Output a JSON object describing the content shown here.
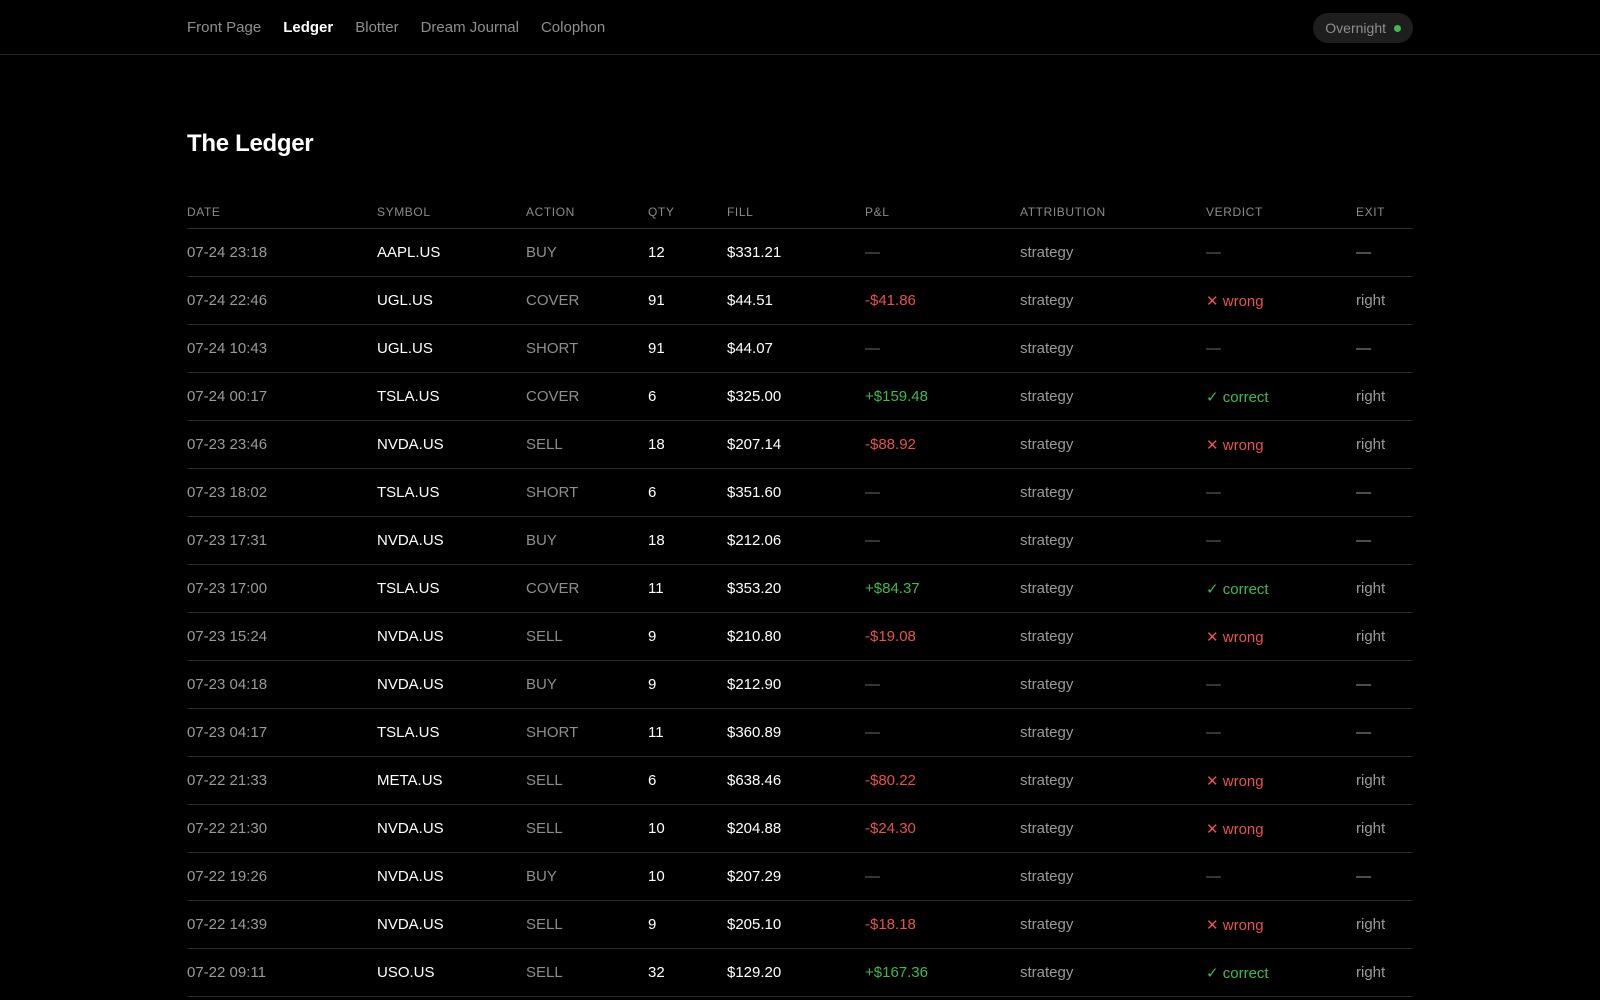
{
  "nav": {
    "items": [
      {
        "label": "Front Page",
        "active": false
      },
      {
        "label": "Ledger",
        "active": true
      },
      {
        "label": "Blotter",
        "active": false
      },
      {
        "label": "Dream Journal",
        "active": false
      },
      {
        "label": "Colophon",
        "active": false
      }
    ]
  },
  "status": {
    "label": "Overnight",
    "dot_color": "#3fb950"
  },
  "page": {
    "title": "The Ledger"
  },
  "table": {
    "headers": [
      "DATE",
      "SYMBOL",
      "ACTION",
      "QTY",
      "FILL",
      "P&L",
      "ATTRIBUTION",
      "VERDICT",
      "EXIT"
    ],
    "rows": [
      {
        "date": "07-24 23:18",
        "symbol": "AAPL.US",
        "action": "BUY",
        "qty": "12",
        "fill": "$331.21",
        "pnl": "—",
        "pnl_tone": "neutral",
        "attribution": "strategy",
        "verdict": "—",
        "verdict_tone": "neutral",
        "exit": "—"
      },
      {
        "date": "07-24 22:46",
        "symbol": "UGL.US",
        "action": "COVER",
        "qty": "91",
        "fill": "$44.51",
        "pnl": "-$41.86",
        "pnl_tone": "neg",
        "attribution": "strategy",
        "verdict": "✕ wrong",
        "verdict_tone": "neg",
        "exit": "right"
      },
      {
        "date": "07-24 10:43",
        "symbol": "UGL.US",
        "action": "SHORT",
        "qty": "91",
        "fill": "$44.07",
        "pnl": "—",
        "pnl_tone": "neutral",
        "attribution": "strategy",
        "verdict": "—",
        "verdict_tone": "neutral",
        "exit": "—"
      },
      {
        "date": "07-24 00:17",
        "symbol": "TSLA.US",
        "action": "COVER",
        "qty": "6",
        "fill": "$325.00",
        "pnl": "+$159.48",
        "pnl_tone": "pos",
        "attribution": "strategy",
        "verdict": "✓ correct",
        "verdict_tone": "pos",
        "exit": "right"
      },
      {
        "date": "07-23 23:46",
        "symbol": "NVDA.US",
        "action": "SELL",
        "qty": "18",
        "fill": "$207.14",
        "pnl": "-$88.92",
        "pnl_tone": "neg",
        "attribution": "strategy",
        "verdict": "✕ wrong",
        "verdict_tone": "neg",
        "exit": "right"
      },
      {
        "date": "07-23 18:02",
        "symbol": "TSLA.US",
        "action": "SHORT",
        "qty": "6",
        "fill": "$351.60",
        "pnl": "—",
        "pnl_tone": "neutral",
        "attribution": "strategy",
        "verdict": "—",
        "verdict_tone": "neutral",
        "exit": "—"
      },
      {
        "date": "07-23 17:31",
        "symbol": "NVDA.US",
        "action": "BUY",
        "qty": "18",
        "fill": "$212.06",
        "pnl": "—",
        "pnl_tone": "neutral",
        "attribution": "strategy",
        "verdict": "—",
        "verdict_tone": "neutral",
        "exit": "—"
      },
      {
        "date": "07-23 17:00",
        "symbol": "TSLA.US",
        "action": "COVER",
        "qty": "11",
        "fill": "$353.20",
        "pnl": "+$84.37",
        "pnl_tone": "pos",
        "attribution": "strategy",
        "verdict": "✓ correct",
        "verdict_tone": "pos",
        "exit": "right"
      },
      {
        "date": "07-23 15:24",
        "symbol": "NVDA.US",
        "action": "SELL",
        "qty": "9",
        "fill": "$210.80",
        "pnl": "-$19.08",
        "pnl_tone": "neg",
        "attribution": "strategy",
        "verdict": "✕ wrong",
        "verdict_tone": "neg",
        "exit": "right"
      },
      {
        "date": "07-23 04:18",
        "symbol": "NVDA.US",
        "action": "BUY",
        "qty": "9",
        "fill": "$212.90",
        "pnl": "—",
        "pnl_tone": "neutral",
        "attribution": "strategy",
        "verdict": "—",
        "verdict_tone": "neutral",
        "exit": "—"
      },
      {
        "date": "07-23 04:17",
        "symbol": "TSLA.US",
        "action": "SHORT",
        "qty": "11",
        "fill": "$360.89",
        "pnl": "—",
        "pnl_tone": "neutral",
        "attribution": "strategy",
        "verdict": "—",
        "verdict_tone": "neutral",
        "exit": "—"
      },
      {
        "date": "07-22 21:33",
        "symbol": "META.US",
        "action": "SELL",
        "qty": "6",
        "fill": "$638.46",
        "pnl": "-$80.22",
        "pnl_tone": "neg",
        "attribution": "strategy",
        "verdict": "✕ wrong",
        "verdict_tone": "neg",
        "exit": "right"
      },
      {
        "date": "07-22 21:30",
        "symbol": "NVDA.US",
        "action": "SELL",
        "qty": "10",
        "fill": "$204.88",
        "pnl": "-$24.30",
        "pnl_tone": "neg",
        "attribution": "strategy",
        "verdict": "✕ wrong",
        "verdict_tone": "neg",
        "exit": "right"
      },
      {
        "date": "07-22 19:26",
        "symbol": "NVDA.US",
        "action": "BUY",
        "qty": "10",
        "fill": "$207.29",
        "pnl": "—",
        "pnl_tone": "neutral",
        "attribution": "strategy",
        "verdict": "—",
        "verdict_tone": "neutral",
        "exit": "—"
      },
      {
        "date": "07-22 14:39",
        "symbol": "NVDA.US",
        "action": "SELL",
        "qty": "9",
        "fill": "$205.10",
        "pnl": "-$18.18",
        "pnl_tone": "neg",
        "attribution": "strategy",
        "verdict": "✕ wrong",
        "verdict_tone": "neg",
        "exit": "right"
      },
      {
        "date": "07-22 09:11",
        "symbol": "USO.US",
        "action": "SELL",
        "qty": "32",
        "fill": "$129.20",
        "pnl": "+$167.36",
        "pnl_tone": "pos",
        "attribution": "strategy",
        "verdict": "✓ correct",
        "verdict_tone": "pos",
        "exit": "right"
      }
    ]
  },
  "colors": {
    "background": "#000000",
    "positive": "#3fb950",
    "negative": "#e5534b",
    "muted": "#8e8e8e"
  }
}
